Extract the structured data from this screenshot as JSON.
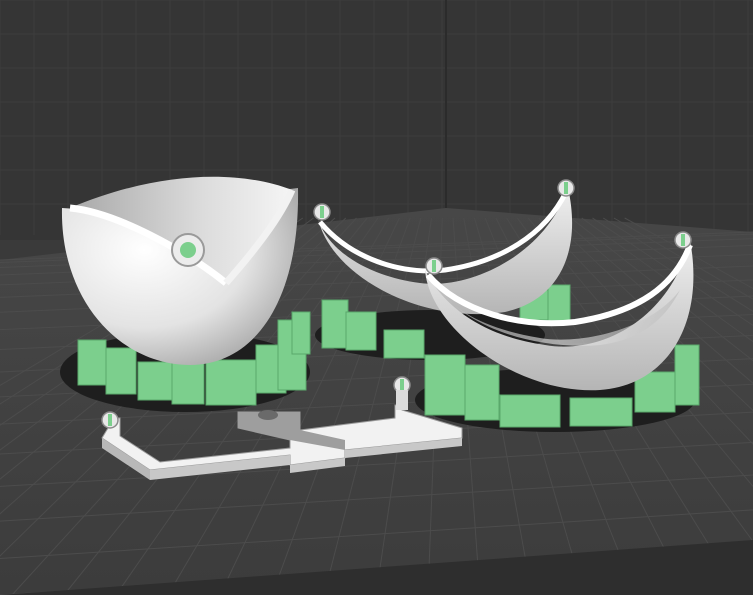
{
  "viewport": {
    "kind": "3d-slicer-build-plate",
    "background_color": "#3a3a3a",
    "wall_color": "#333333",
    "plate_color": "#3f3f3f",
    "grid_color": "#4a4a4a",
    "model_color": "#e6e6e6",
    "support_color": "#7ccf8d",
    "shadow_color": "#1e1e1e"
  },
  "objects": [
    {
      "name": "sphere-half-with-cutout",
      "has_supports": true
    },
    {
      "name": "curved-shell-back",
      "has_supports": true
    },
    {
      "name": "curved-shell-front",
      "has_supports": true
    },
    {
      "name": "flat-bracket-part",
      "has_supports": false
    }
  ]
}
